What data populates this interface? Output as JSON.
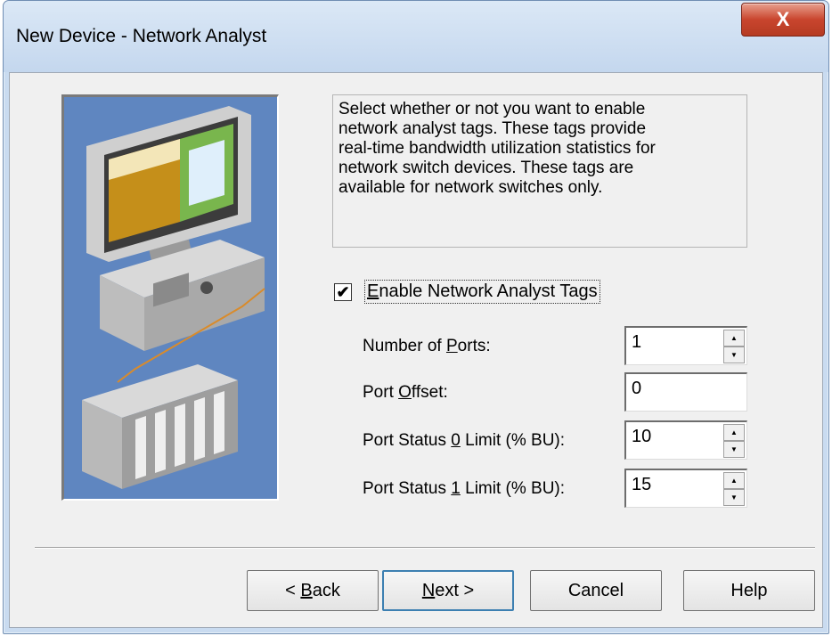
{
  "window": {
    "title": "New Device - Network Analyst",
    "close_label": "X"
  },
  "description": "Select whether or not you want to enable\nnetwork analyst tags.  These tags provide\nreal-time bandwidth utilization statistics for\nnetwork switch devices. These tags are\navailable for network switches only.",
  "enable_tags": {
    "checked": true,
    "check_glyph": "✔",
    "label_pre": "",
    "label_accel": "E",
    "label_post": "nable Network Analyst Tags"
  },
  "fields": {
    "ports": {
      "label_pre": "Number of ",
      "label_accel": "P",
      "label_post": "orts:",
      "value": "1"
    },
    "offset": {
      "label_pre": "Port ",
      "label_accel": "O",
      "label_post": "ffset:",
      "value": "0"
    },
    "status0": {
      "label_pre": "Port Status ",
      "label_accel": "0",
      "label_post": " Limit (% BU):",
      "value": "10"
    },
    "status1": {
      "label_pre": "Port Status ",
      "label_accel": "1",
      "label_post": " Limit (% BU):",
      "value": "15"
    }
  },
  "buttons": {
    "back": {
      "pre": "< ",
      "accel": "B",
      "post": "ack"
    },
    "next": {
      "pre": "",
      "accel": "N",
      "post": "ext >"
    },
    "cancel": "Cancel",
    "help": "Help"
  },
  "icons": {
    "illustration": "computer-plc-network-illustration",
    "close": "close-icon",
    "spin_up": "spin-up-arrow-icon",
    "spin_down": "spin-down-arrow-icon"
  },
  "colors": {
    "illustration_bg": "#5f86c0",
    "close_button": "#c9452e",
    "default_button_border": "#3c7fb1"
  }
}
